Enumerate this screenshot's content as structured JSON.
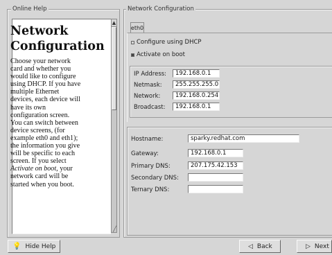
{
  "help": {
    "group_title": "Online Help",
    "title": "Network Configuration",
    "body_lines": [
      "Choose your network",
      "card and whether you",
      "would like to configure",
      "using DHCP. If you have",
      "multiple Ethernet",
      "devices, each device will",
      "have its own",
      "configuration screen.",
      "You can switch between",
      "device screens, (for",
      "example eth0 and eth1);",
      "the information you give",
      "will be specific to each",
      "screen. If you select",
      "Activate on boot, your",
      "network card will be",
      "started when you boot."
    ]
  },
  "netconf": {
    "group_title": "Network Configuration",
    "tab_label": "eth0",
    "dhcp_label": "Configure using DHCP",
    "dhcp_checked": false,
    "boot_label": "Activate on boot",
    "boot_checked": true,
    "ip": {
      "label": "IP Address:",
      "value": "192.168.0.1"
    },
    "netmask": {
      "label": "Netmask:",
      "value": "255.255.255.0"
    },
    "network": {
      "label": "Network:",
      "value": "192.168.0.254"
    },
    "broadcast": {
      "label": "Broadcast:",
      "value": "192.168.0.1"
    }
  },
  "host": {
    "hostname": {
      "label": "Hostname:",
      "value": "sparky.redhat.com"
    },
    "gateway": {
      "label": "Gateway:",
      "value": "192.168.0.1"
    },
    "dns1": {
      "label": "Primary DNS:",
      "value": "207.175.42.153"
    },
    "dns2": {
      "label": "Secondary DNS:",
      "value": ""
    },
    "dns3": {
      "label": "Ternary DNS:",
      "value": ""
    }
  },
  "buttons": {
    "hide_help": "Hide Help",
    "back": "Back",
    "next": "Next"
  }
}
